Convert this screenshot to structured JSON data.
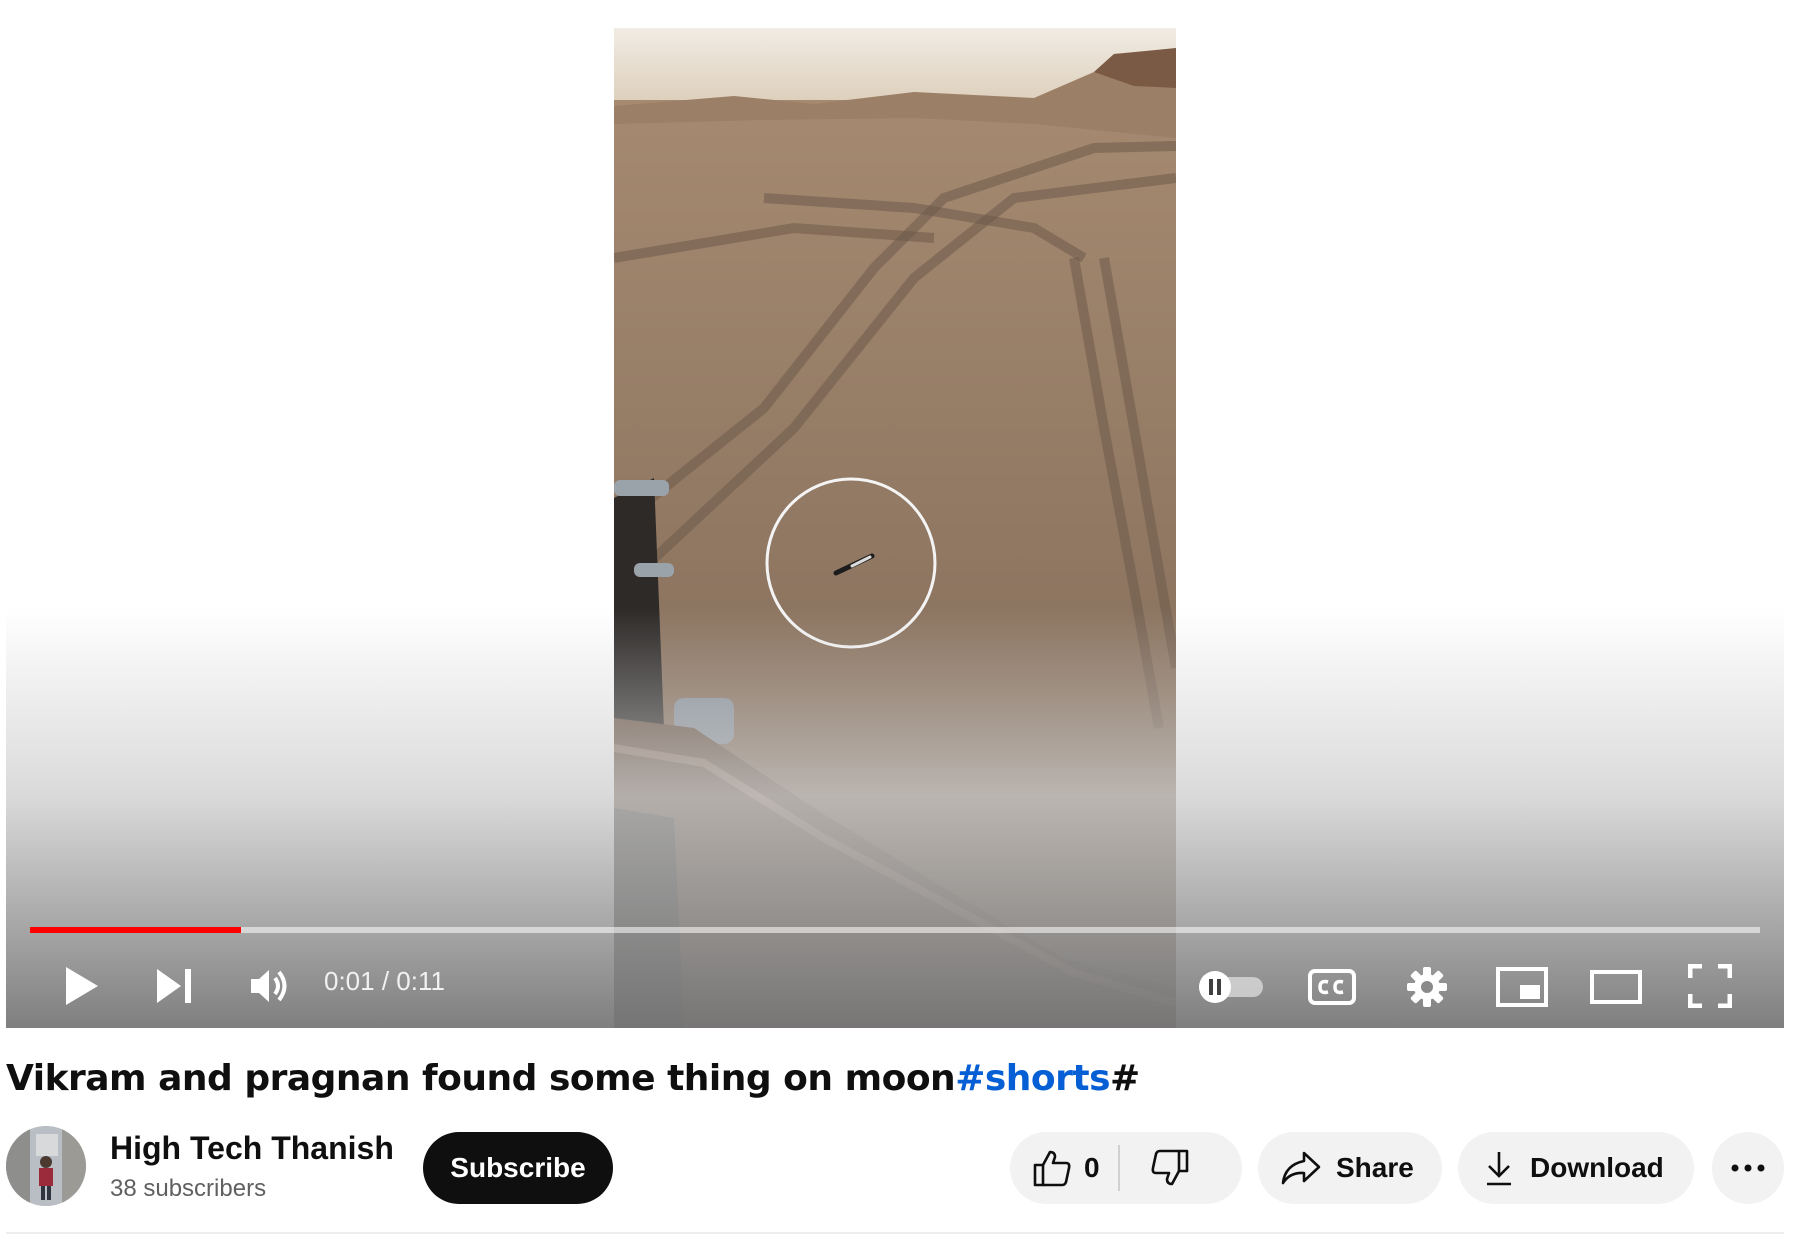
{
  "player": {
    "time_current": "0:01",
    "time_separator": " / ",
    "time_total": "0:11",
    "progress_fraction": 0.122,
    "accent_color": "#ff0000",
    "controls": [
      "play-icon",
      "next-icon",
      "volume-icon",
      "autoplay-toggle-icon",
      "captions-icon",
      "settings-icon",
      "miniplayer-icon",
      "theater-mode-icon",
      "fullscreen-icon"
    ]
  },
  "video": {
    "title_text": "Vikram and pragnan found some thing on moon",
    "title_hashtag": "#shorts",
    "title_suffix": "#"
  },
  "channel": {
    "name": "High Tech Thanish",
    "subscribers": "38 subscribers",
    "subscribe_label": "Subscribe"
  },
  "actions": {
    "like_count": "0",
    "share_label": "Share",
    "download_label": "Download",
    "link_color": "#065fd4"
  }
}
